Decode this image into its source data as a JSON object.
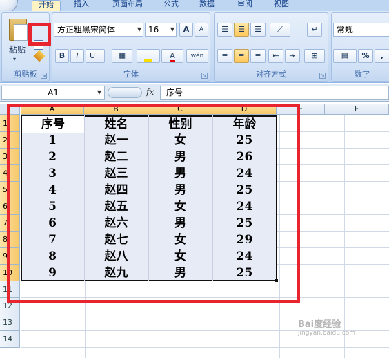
{
  "tabs": [
    "开始",
    "插入",
    "页面布局",
    "公式",
    "数据",
    "审阅",
    "视图"
  ],
  "ribbon": {
    "clipboard": {
      "paste_label": "粘贴",
      "group_label": "剪贴板"
    },
    "font": {
      "font_name": "方正粗黑宋简体",
      "font_size": "16",
      "grow_label": "A",
      "shrink_label": "A",
      "bold": "B",
      "italic": "I",
      "underline": "U",
      "font_color_label": "A",
      "phonetic_label": "wén",
      "group_label": "字体"
    },
    "alignment": {
      "group_label": "对齐方式"
    },
    "number": {
      "format": "常规",
      "percent": "%",
      "comma": ",",
      "group_label": "数字"
    }
  },
  "formula_bar": {
    "name_box": "A1",
    "fx_label": "fx",
    "content": "序号"
  },
  "columns": [
    "A",
    "B",
    "C",
    "D",
    "E",
    "F"
  ],
  "rows": [
    "1",
    "2",
    "3",
    "4",
    "5",
    "6",
    "7",
    "8",
    "9",
    "10",
    "11",
    "12",
    "13",
    "14"
  ],
  "table": {
    "header": [
      "序号",
      "姓名",
      "性别",
      "年龄"
    ],
    "rows": [
      [
        "1",
        "赵一",
        "女",
        "25"
      ],
      [
        "2",
        "赵二",
        "男",
        "26"
      ],
      [
        "3",
        "赵三",
        "男",
        "24"
      ],
      [
        "4",
        "赵四",
        "男",
        "25"
      ],
      [
        "5",
        "赵五",
        "女",
        "24"
      ],
      [
        "6",
        "赵六",
        "男",
        "25"
      ],
      [
        "7",
        "赵七",
        "女",
        "29"
      ],
      [
        "8",
        "赵八",
        "女",
        "24"
      ],
      [
        "9",
        "赵九",
        "男",
        "25"
      ]
    ]
  },
  "watermark": {
    "text": "Bai度经验",
    "sub": "jingyan.baidu.com"
  },
  "colors": {
    "highlight_red": "#e8242f",
    "ribbon_blue": "#c7dbf3",
    "selection_fill": "#e6ebf6"
  }
}
